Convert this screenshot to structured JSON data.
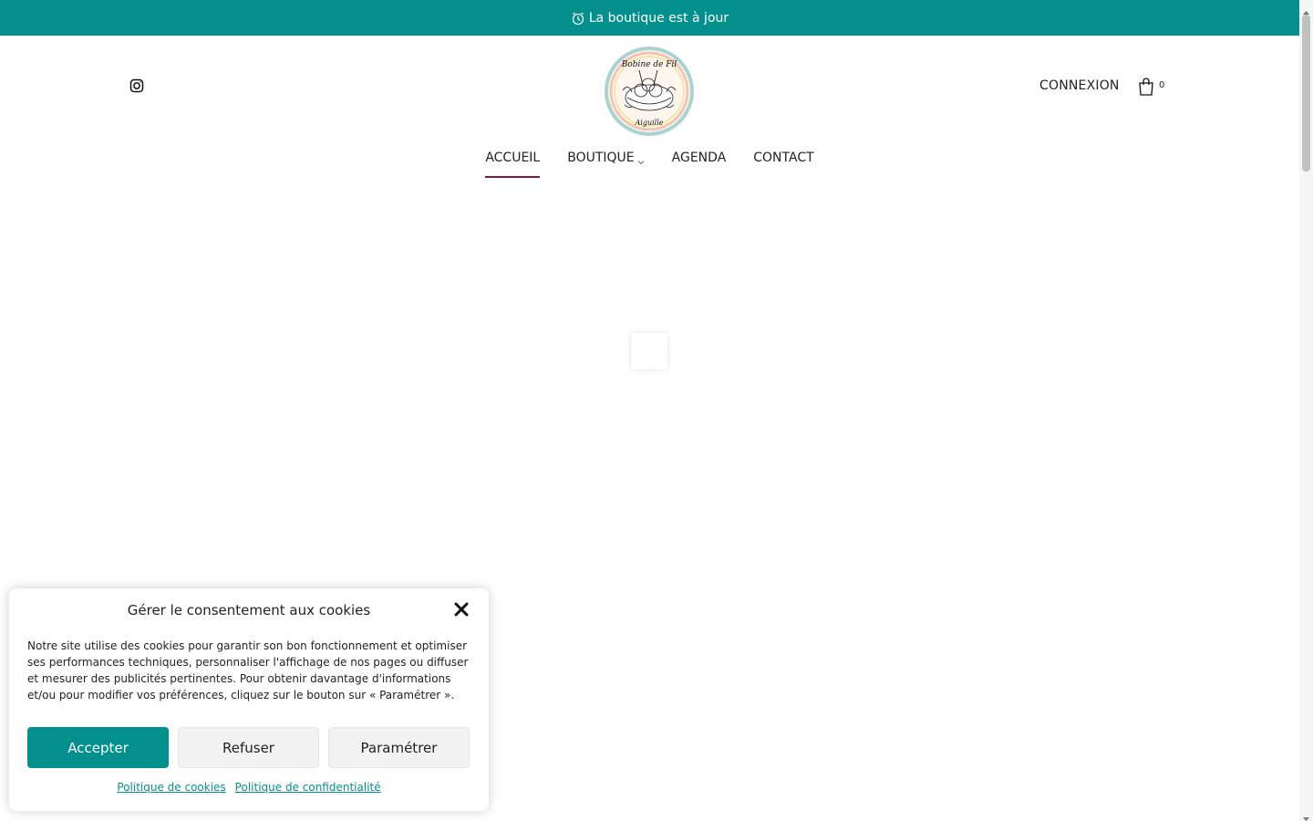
{
  "topbar": {
    "icon": "alarm-clock-icon",
    "text": "La boutique est à jour",
    "bg_color": "#03908d"
  },
  "header": {
    "social_icon": "instagram-icon",
    "logo": {
      "alt": "Bobine de fil et aiguille logo",
      "text_top": "Bobine de Fil",
      "text_bottom": "Aiguille"
    },
    "login_label": "CONNEXION",
    "cart_icon": "shopping-bag-icon",
    "cart_count": "0"
  },
  "nav": {
    "items": [
      {
        "label": "ACCUEIL",
        "active": true
      },
      {
        "label": "BOUTIQUE",
        "has_dropdown": true
      },
      {
        "label": "AGENDA"
      },
      {
        "label": "CONTACT"
      }
    ],
    "active_color": "#8a1538"
  },
  "cookie_banner": {
    "title": "Gérer le consentement aux cookies",
    "text": "Notre site utilise des cookies pour garantir son bon fonctionnement et optimiser ses performances techniques, personnaliser l'affichage de nos pages ou diffuser et mesurer des publicités pertinentes. Pour obtenir davantage d'informations et/ou pour modifier vos préférences, cliquez sur le bouton sur « Paramétrer ».",
    "accept_label": "Accepter",
    "deny_label": "Refuser",
    "settings_label": "Paramétrer",
    "cookie_policy_link": "Politique de cookies",
    "privacy_policy_link": "Politique de confidentialité",
    "accent_color": "#03908d"
  }
}
